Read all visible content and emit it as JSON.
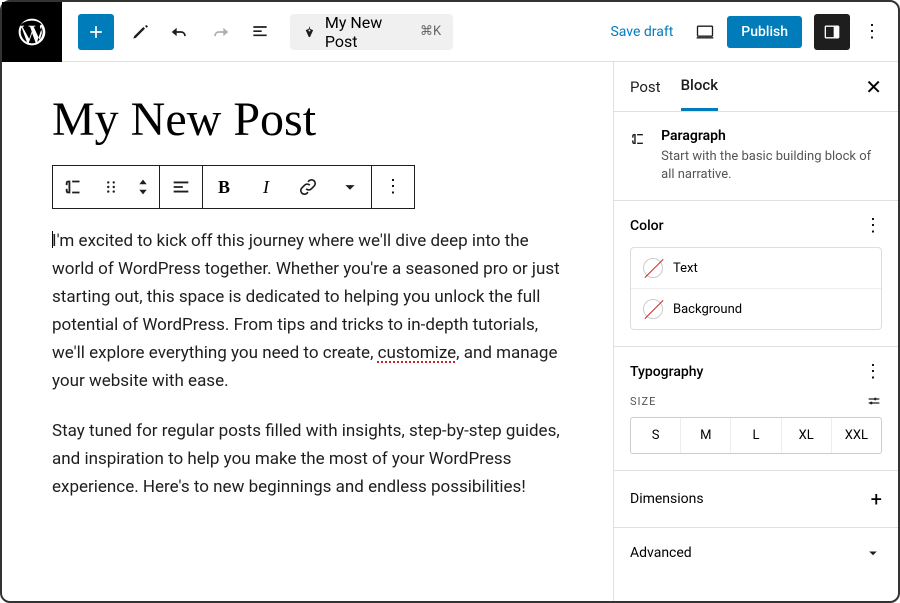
{
  "topbar": {
    "title": "My New Post",
    "shortcut": "⌘K",
    "save_draft": "Save draft",
    "publish": "Publish"
  },
  "editor": {
    "post_title": "My New Post",
    "paragraph1": "I'm excited to kick off this journey where we'll dive deep into the world of WordPress together. Whether you're a seasoned pro or just starting out, this space is dedicated to helping you unlock the full potential of WordPress. From tips and tricks to in-depth tutorials, we'll explore everything you need to create, ",
    "paragraph1_mis": "customize",
    "paragraph1_tail": ", and manage your website with ease.",
    "paragraph2": "Stay tuned for regular posts filled with insights, step-by-step guides, and inspiration to help you make the most of your WordPress experience. Here's to new beginnings and endless possibilities!"
  },
  "sidebar": {
    "tabs": {
      "post": "Post",
      "block": "Block"
    },
    "block_name": "Paragraph",
    "block_desc": "Start with the basic building block of all narrative.",
    "color_label": "Color",
    "color_text": "Text",
    "color_bg": "Background",
    "typo_label": "Typography",
    "size_label": "SIZE",
    "sizes": [
      "S",
      "M",
      "L",
      "XL",
      "XXL"
    ],
    "dimensions": "Dimensions",
    "advanced": "Advanced"
  }
}
